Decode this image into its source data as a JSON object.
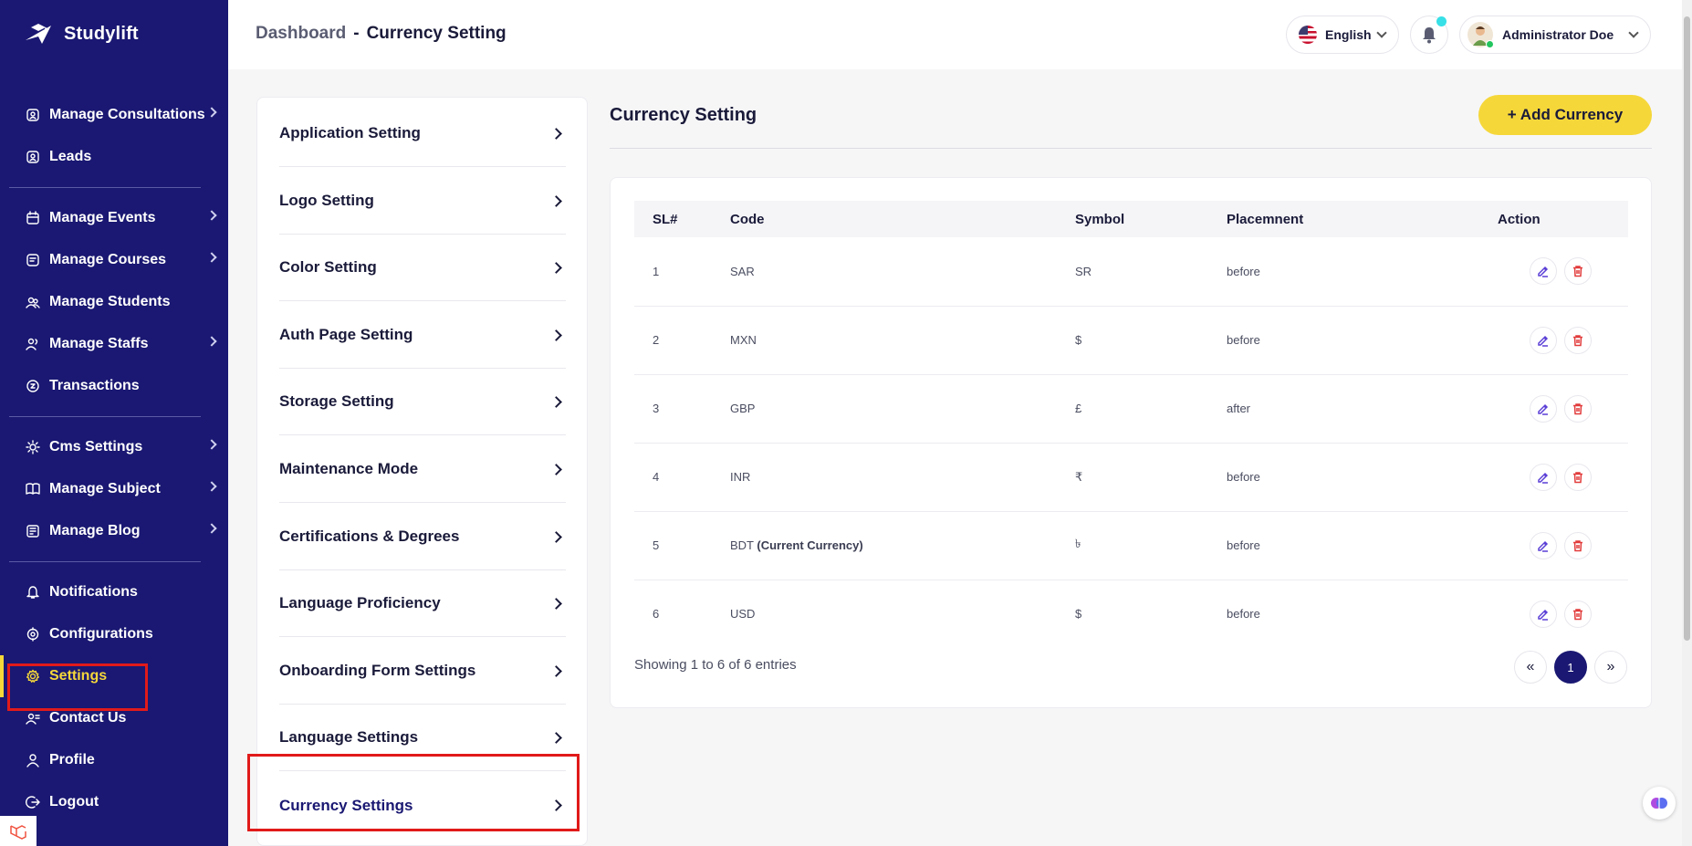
{
  "brand": {
    "name": "Studylift"
  },
  "sidebar": {
    "groups": [
      [
        {
          "label": "Manage Consultations",
          "icon": "consultation-icon",
          "has_submenu": true
        },
        {
          "label": "Leads",
          "icon": "leads-icon",
          "has_submenu": false
        }
      ],
      [
        {
          "label": "Manage Events",
          "icon": "calendar-icon",
          "has_submenu": true
        },
        {
          "label": "Manage Courses",
          "icon": "courses-icon",
          "has_submenu": true
        },
        {
          "label": "Manage Students",
          "icon": "students-icon",
          "has_submenu": false
        },
        {
          "label": "Manage Staffs",
          "icon": "staffs-icon",
          "has_submenu": true
        },
        {
          "label": "Transactions",
          "icon": "transactions-icon",
          "has_submenu": false
        }
      ],
      [
        {
          "label": "Cms Settings",
          "icon": "cms-icon",
          "has_submenu": true
        },
        {
          "label": "Manage Subject",
          "icon": "book-icon",
          "has_submenu": true
        },
        {
          "label": "Manage Blog",
          "icon": "blog-icon",
          "has_submenu": true
        }
      ],
      [
        {
          "label": "Notifications",
          "icon": "bell-icon",
          "has_submenu": false
        },
        {
          "label": "Configurations",
          "icon": "config-icon",
          "has_submenu": false
        },
        {
          "label": "Settings",
          "icon": "gear-icon",
          "has_submenu": false,
          "active": true
        },
        {
          "label": "Contact Us",
          "icon": "contact-icon",
          "has_submenu": false
        },
        {
          "label": "Profile",
          "icon": "user-icon",
          "has_submenu": false
        },
        {
          "label": "Logout",
          "icon": "logout-icon",
          "has_submenu": false
        }
      ]
    ]
  },
  "header": {
    "breadcrumb_home": "Dashboard",
    "breadcrumb_sep": "-",
    "breadcrumb_current": "Currency Setting",
    "language": "English",
    "user_name": "Administrator Doe"
  },
  "settings_menu": [
    {
      "label": "Application Setting"
    },
    {
      "label": "Logo Setting"
    },
    {
      "label": "Color Setting"
    },
    {
      "label": "Auth Page Setting"
    },
    {
      "label": "Storage Setting"
    },
    {
      "label": "Maintenance Mode"
    },
    {
      "label": "Certifications & Degrees"
    },
    {
      "label": "Language Proficiency"
    },
    {
      "label": "Onboarding Form Settings"
    },
    {
      "label": "Language Settings"
    },
    {
      "label": "Currency Settings",
      "current": true
    }
  ],
  "content": {
    "title": "Currency Setting",
    "add_button": "+ Add Currency",
    "table": {
      "headers": [
        "SL#",
        "Code",
        "Symbol",
        "Placemnent",
        "Action"
      ],
      "rows": [
        {
          "sl": "1",
          "code": "SAR",
          "tag": "",
          "symbol": "SR",
          "placement": "before"
        },
        {
          "sl": "2",
          "code": "MXN",
          "tag": "",
          "symbol": "$",
          "placement": "before"
        },
        {
          "sl": "3",
          "code": "GBP",
          "tag": "",
          "symbol": "£",
          "placement": "after"
        },
        {
          "sl": "4",
          "code": "INR",
          "tag": "",
          "symbol": "₹",
          "placement": "before"
        },
        {
          "sl": "5",
          "code": "BDT",
          "tag": "(Current Currency)",
          "symbol": "৳",
          "placement": "before"
        },
        {
          "sl": "6",
          "code": "USD",
          "tag": "",
          "symbol": "$",
          "placement": "before"
        }
      ]
    },
    "showing": "Showing 1 to 6 of 6 entries",
    "pagination": {
      "prev": "«",
      "current": "1",
      "next": "»"
    }
  },
  "colors": {
    "sidebar_bg": "#1a1872",
    "accent_yellow": "#f5d73a",
    "highlight_red": "#e11a1a",
    "edit_icon": "#5b3fd6",
    "delete_icon": "#e23b3b"
  }
}
